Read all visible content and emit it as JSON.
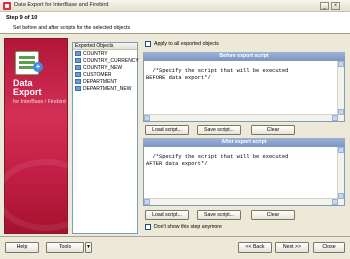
{
  "window": {
    "title": "Data Export for InterBase and Firebird"
  },
  "header": {
    "step": "Step 9 of 10",
    "subtitle": "Set before and after scripts for the selected objects"
  },
  "banner": {
    "line1": "Data",
    "line2": "Export",
    "line3": "for InterBase / Firebird"
  },
  "objects": {
    "header": "Exported Objects",
    "items": [
      "COUNTRY",
      "COUNTRY_CURRENCY",
      "COUNTRY_NEW",
      "CUSTOMER",
      "DEPARTMENT",
      "DEPARTMENT_NEW"
    ]
  },
  "apply_all": {
    "label": "Apply to all exported objects",
    "checked": false
  },
  "before": {
    "title": "Before export script",
    "text": "/*Specify the script that will be executed\nBEFORE data export*/"
  },
  "after": {
    "title": "After export script",
    "text": "/*Specify the script that will be executed\nAFTER data export*/"
  },
  "script_buttons": {
    "load": "Load script...",
    "save": "Save script...",
    "clear": "Clear"
  },
  "dont_show": {
    "label": "Don't show this step anymore",
    "checked": false
  },
  "footer": {
    "help": "Help",
    "tools": "Tools",
    "back": "<< Back",
    "next": "Next >>",
    "close": "Close"
  },
  "colors": {
    "banner": "#c21e45",
    "section_header": "#8ea6cf"
  }
}
